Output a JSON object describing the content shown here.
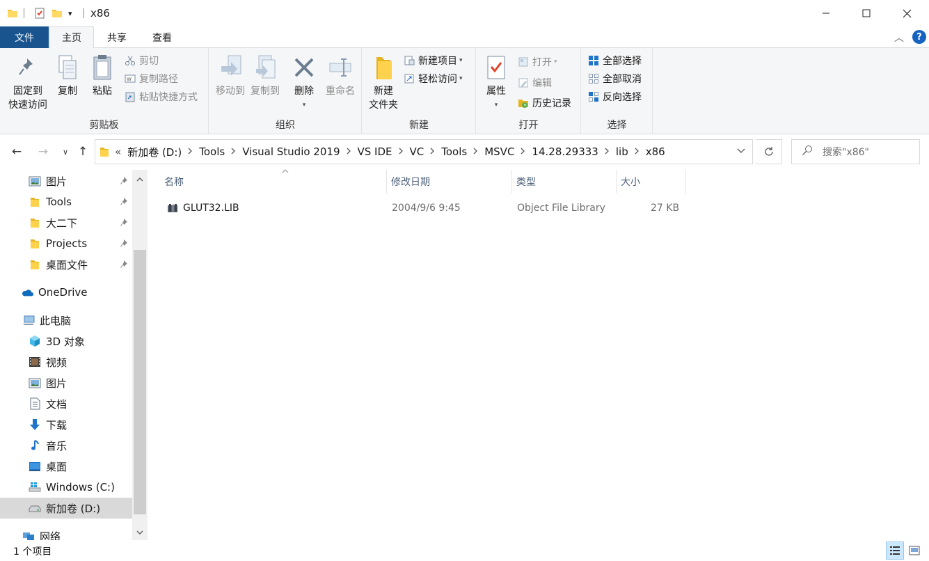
{
  "window": {
    "title": "x86",
    "minimize": "—",
    "maximize": "☐",
    "close": "✕"
  },
  "tabs": {
    "file": "文件",
    "home": "主页",
    "share": "共享",
    "view": "查看"
  },
  "ribbon": {
    "clipboard": {
      "label": "剪贴板",
      "pin_line1": "固定到",
      "pin_line2": "快速访问",
      "copy": "复制",
      "paste": "粘贴",
      "cut": "剪切",
      "copy_path": "复制路径",
      "paste_shortcut": "粘贴快捷方式"
    },
    "organize": {
      "label": "组织",
      "move_to": "移动到",
      "copy_to": "复制到",
      "delete": "删除",
      "rename": "重命名"
    },
    "new": {
      "label": "新建",
      "new_folder_line1": "新建",
      "new_folder_line2": "文件夹",
      "new_item": "新建项目",
      "easy_access": "轻松访问"
    },
    "open": {
      "label": "打开",
      "properties": "属性",
      "open": "打开",
      "edit": "编辑",
      "history": "历史记录"
    },
    "select": {
      "label": "选择",
      "select_all": "全部选择",
      "select_none": "全部取消",
      "invert": "反向选择"
    }
  },
  "address": {
    "overflow": "«",
    "crumbs": [
      "新加卷 (D:)",
      "Tools",
      "Visual Studio 2019",
      "VS IDE",
      "VC",
      "Tools",
      "MSVC",
      "14.28.29333",
      "lib",
      "x86"
    ],
    "search_placeholder": "搜索\"x86\""
  },
  "navpane": {
    "quick": [
      {
        "label": "图片",
        "icon": "pictures-icon"
      },
      {
        "label": "Tools",
        "icon": "folder-icon"
      },
      {
        "label": "大二下",
        "icon": "folder-icon"
      },
      {
        "label": "Projects",
        "icon": "folder-icon"
      },
      {
        "label": "桌面文件",
        "icon": "folder-icon"
      }
    ],
    "onedrive": "OneDrive",
    "this_pc": "此电脑",
    "pc_items": [
      {
        "label": "3D 对象",
        "icon": "3d-objects-icon"
      },
      {
        "label": "视频",
        "icon": "videos-icon"
      },
      {
        "label": "图片",
        "icon": "pictures-icon"
      },
      {
        "label": "文档",
        "icon": "documents-icon"
      },
      {
        "label": "下载",
        "icon": "downloads-icon"
      },
      {
        "label": "音乐",
        "icon": "music-icon"
      },
      {
        "label": "桌面",
        "icon": "desktop-icon"
      },
      {
        "label": "Windows (C:)",
        "icon": "windows-drive-icon"
      },
      {
        "label": "新加卷 (D:)",
        "icon": "drive-icon"
      }
    ],
    "network": "网络"
  },
  "columns": {
    "name": "名称",
    "date": "修改日期",
    "type": "类型",
    "size": "大小"
  },
  "files": [
    {
      "name": "GLUT32.LIB",
      "date": "2004/9/6 9:45",
      "type": "Object File Library",
      "size": "27 KB"
    }
  ],
  "status": {
    "count": "1 个项目"
  },
  "colors": {
    "file_tab": "#19548f",
    "ribbon_bg": "#f5f6f7",
    "selected_nav": "#d9d9d9",
    "folder_yellow": "#f4c430"
  }
}
